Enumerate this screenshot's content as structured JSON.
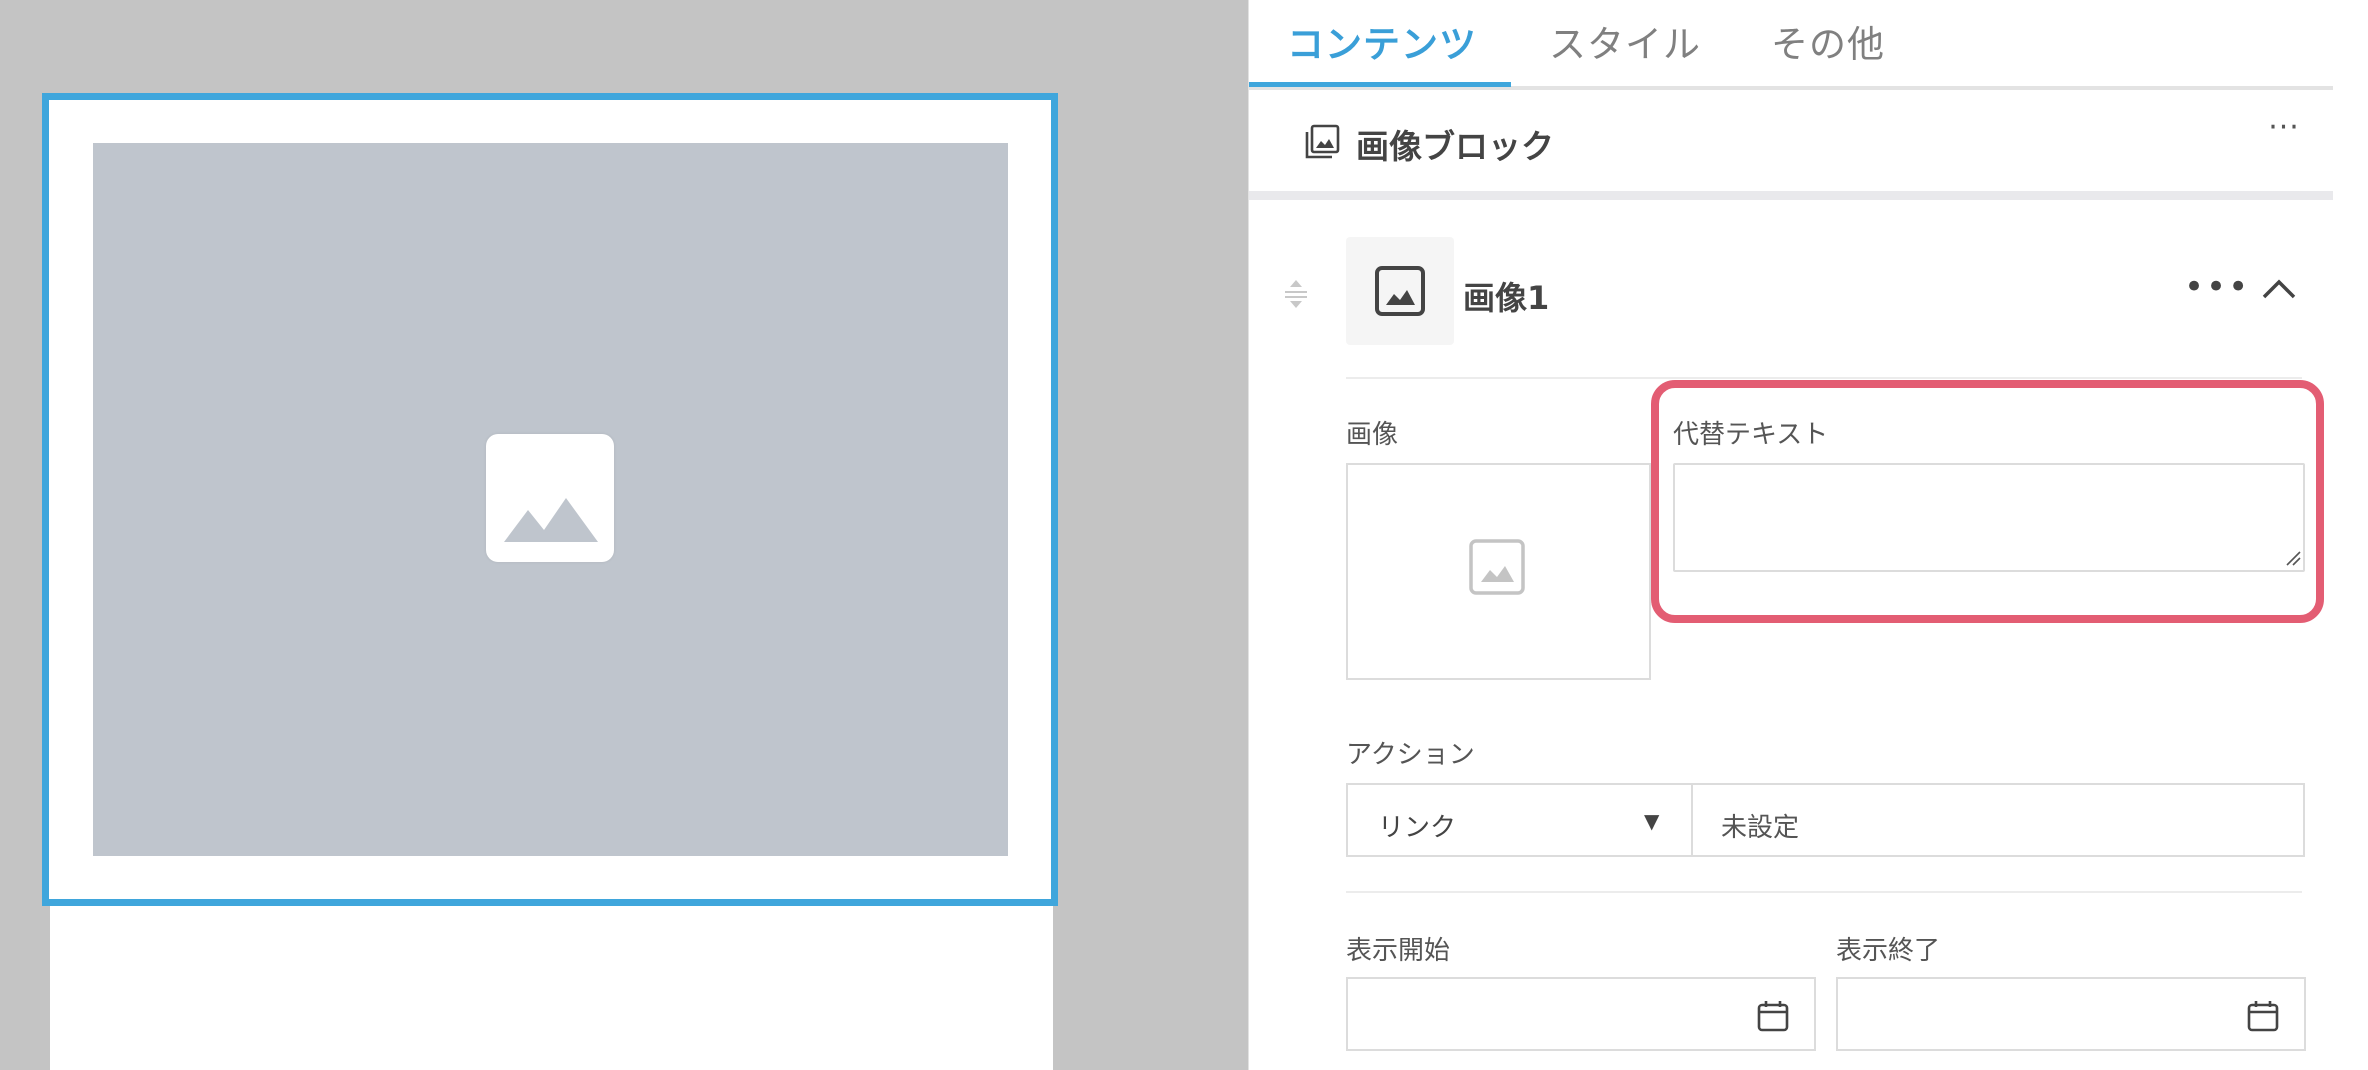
{
  "tabs": [
    {
      "label": "コンテンツ",
      "active": true
    },
    {
      "label": "スタイル",
      "active": false
    },
    {
      "label": "その他",
      "active": false
    }
  ],
  "block": {
    "title": "画像ブロック",
    "menu": "···",
    "icon": "image-block-icon"
  },
  "item": {
    "title": "画像1",
    "menu": "•••",
    "thumb_icon": "image-icon",
    "collapse_icon": "chevron-up-icon"
  },
  "fields": {
    "image_label": "画像",
    "alt_label": "代替テキスト",
    "alt_value": "",
    "action_label": "アクション",
    "action_type": "リンク",
    "action_target": "未設定",
    "start_label": "表示開始",
    "end_label": "表示終了"
  },
  "colors": {
    "accent": "#3fa6dc",
    "highlight": "#e35d73",
    "placeholder": "#bfc5cd",
    "canvas_bg": "#c4c4c4"
  }
}
